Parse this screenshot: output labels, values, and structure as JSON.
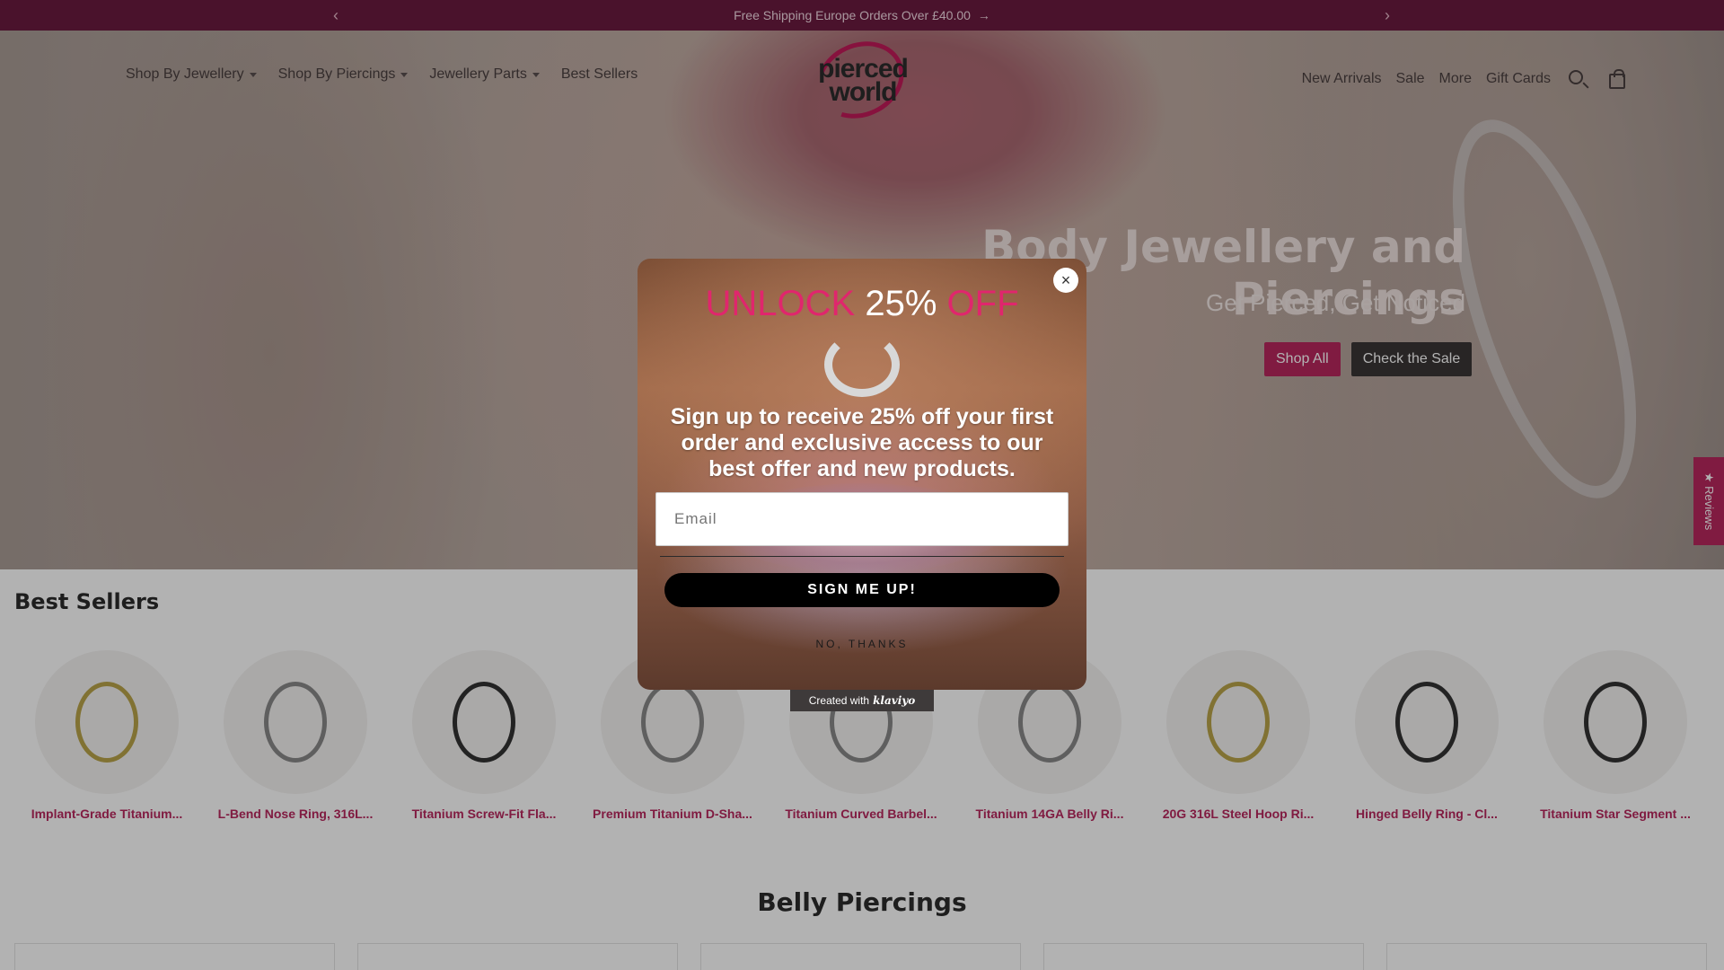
{
  "announcement": {
    "text": "Free Shipping Europe Orders Over £40.00",
    "prev_icon": "‹",
    "next_icon": "›",
    "arrow_icon": "→"
  },
  "header": {
    "logo_line1": "pierced",
    "logo_line2": "world",
    "nav_left": [
      {
        "label": "Shop By Jewellery"
      },
      {
        "label": "Shop By Piercings"
      },
      {
        "label": "Jewellery Parts"
      },
      {
        "label": "Best Sellers"
      }
    ],
    "nav_right": [
      {
        "label": "New Arrivals"
      },
      {
        "label": "Sale"
      },
      {
        "label": "More"
      },
      {
        "label": "Gift Cards"
      }
    ]
  },
  "hero": {
    "title": "Body Jewellery and Piercings",
    "subtitle": "Get Pierced, Get Noticed",
    "btn_shop_all": "Shop All",
    "btn_check_sale": "Check the Sale"
  },
  "reviews_tab": "★ Reviews",
  "best_sellers": {
    "title": "Best Sellers",
    "products": [
      {
        "name": "Implant-Grade Titanium..."
      },
      {
        "name": "L-Bend Nose Ring, 316L..."
      },
      {
        "name": "Titanium Screw-Fit Fla..."
      },
      {
        "name": "Premium Titanium D-Sha..."
      },
      {
        "name": "Titanium Curved Barbel..."
      },
      {
        "name": "Titanium 14GA Belly Ri..."
      },
      {
        "name": "20G 316L Steel Hoop Ri..."
      },
      {
        "name": "Hinged Belly Ring - Cl..."
      },
      {
        "name": "Titanium Star Segment ..."
      }
    ]
  },
  "belly": {
    "title": "Belly Piercings"
  },
  "popup": {
    "headline_unlock": "UNLOCK",
    "headline_pct": "25%",
    "headline_off": "OFF",
    "body": "Sign up to receive 25% off your first order and exclusive access to our best offer and new products.",
    "email_placeholder": "Email",
    "signup_label": "SIGN ME UP!",
    "no_thanks": "NO, THANKS",
    "close_icon": "×"
  },
  "klaviyo": {
    "prefix": "Created with",
    "brand": "klaviyo"
  },
  "colors": {
    "brand_pink": "#b8285e",
    "announce_bg": "#6b1b3f",
    "popup_pink": "#e0266d"
  }
}
